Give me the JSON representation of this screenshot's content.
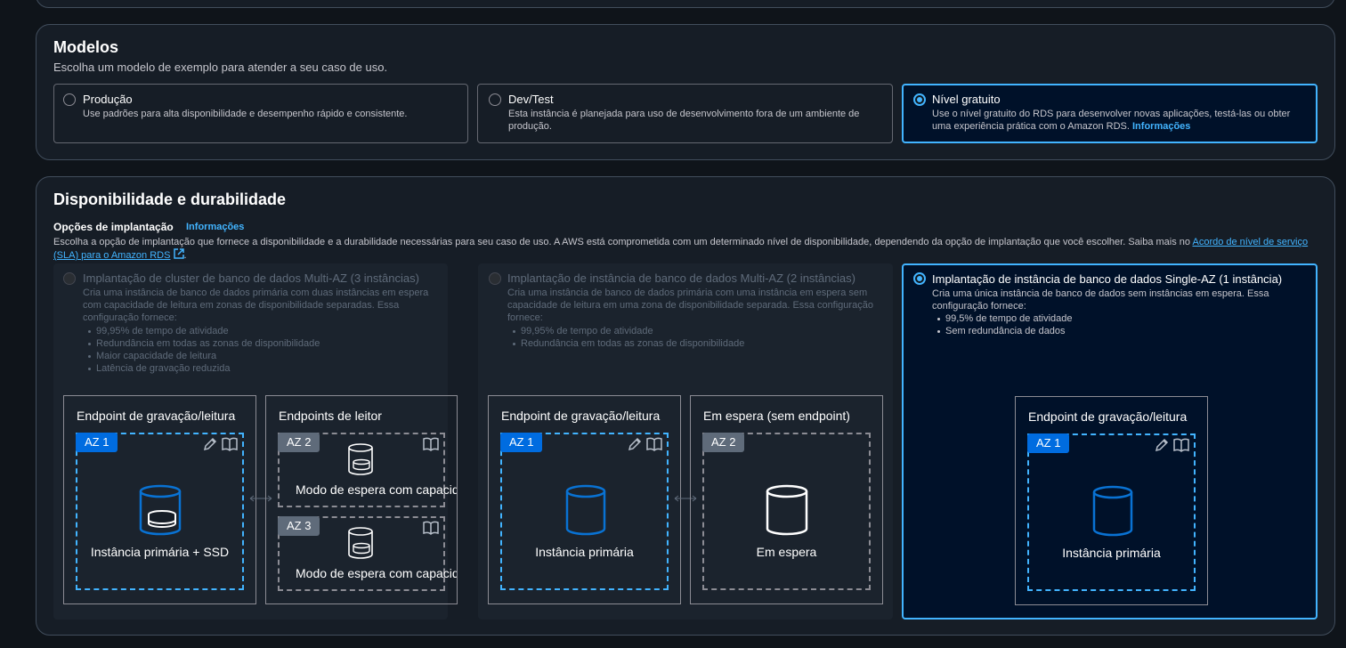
{
  "models": {
    "title": "Modelos",
    "subtitle": "Escolha um modelo de exemplo para atender a seu caso de uso.",
    "options": [
      {
        "label": "Produção",
        "description": "Use padrões para alta disponibilidade e desempenho rápido e consistente."
      },
      {
        "label": "Dev/Test",
        "description": "Esta instância é planejada para uso de desenvolvimento fora de um ambiente de produção."
      },
      {
        "label": "Nível gratuito",
        "description": "Use o nível gratuito do RDS para desenvolver novas aplicações, testá-las ou obter uma experiência prática com o Amazon RDS.",
        "info_link": "Informações"
      }
    ]
  },
  "availability": {
    "title": "Disponibilidade e durabilidade",
    "deployment_label": "Opções de implantação",
    "info_link": "Informações",
    "description": "Escolha a opção de implantação que fornece a disponibilidade e a durabilidade necessárias para seu caso de uso. A AWS está comprometida com um determinado nível de disponibilidade, dependendo da opção de implantação que você escolher. Saiba mais no",
    "sla_link": "Acordo de nível de serviço (SLA) para o Amazon RDS",
    "description_end": ".",
    "options": [
      {
        "label": "Implantação de cluster de banco de dados Multi-AZ (3 instâncias)",
        "description": "Cria uma instância de banco de dados primária com duas instâncias em espera com capacidade de leitura em zonas de disponibilidade separadas. Essa configuração fornece:",
        "bullets": [
          "99,95% de tempo de atividade",
          "Redundância em todas as zonas de disponibilidade",
          "Maior capacidade de leitura",
          "Latência de gravação reduzida"
        ],
        "box1_title": "Endpoint de gravação/leitura",
        "box1_az": "AZ 1",
        "box1_caption": "Instância primária + SSD",
        "box2_title": "Endpoints de leitor",
        "box2_az_a": "AZ 2",
        "box2_caption_a": "Modo de espera com capacidade de leitura",
        "box2_az_b": "AZ 3",
        "box2_caption_b": "Modo de espera com capacidade de leitura"
      },
      {
        "label": "Implantação de instância de banco de dados Multi-AZ (2 instâncias)",
        "description": "Cria uma instância de banco de dados primária com uma instância em espera sem capacidade de leitura em uma zona de disponibilidade separada. Essa configuração fornece:",
        "bullets": [
          "99,95% de tempo de atividade",
          "Redundância em todas as zonas de disponibilidade"
        ],
        "box1_title": "Endpoint de gravação/leitura",
        "box1_az": "AZ 1",
        "box1_caption": "Instância primária",
        "box2_title": "Em espera (sem endpoint)",
        "box2_az": "AZ 2",
        "box2_caption": "Em espera"
      },
      {
        "label": "Implantação de instância de banco de dados Single-AZ (1 instância)",
        "description": "Cria uma única instância de banco de dados sem instâncias em espera. Essa configuração fornece:",
        "bullets": [
          "99,5% de tempo de atividade",
          "Sem redundância de dados"
        ],
        "box1_title": "Endpoint de gravação/leitura",
        "box1_az": "AZ 1",
        "box1_caption": "Instância primária"
      }
    ]
  },
  "colors": {
    "accent": "#42b4ff",
    "badge": "#006ce0",
    "panel": "#161d26",
    "background": "#0f141a"
  }
}
